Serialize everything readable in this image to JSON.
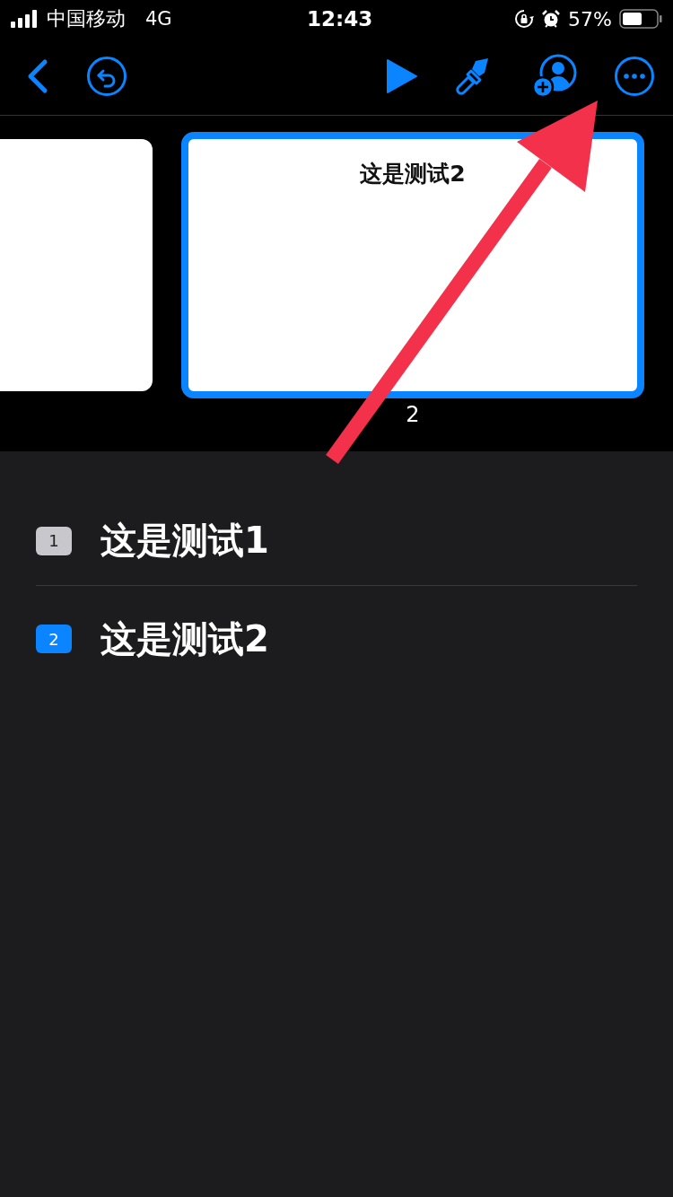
{
  "status_bar": {
    "carrier": "中国移动",
    "network": "4G",
    "time": "12:43",
    "battery_percent": "57%"
  },
  "toolbar": {
    "buttons": [
      {
        "kind": "back"
      },
      {
        "kind": "undo"
      },
      {
        "kind": "play"
      },
      {
        "kind": "brush"
      },
      {
        "kind": "collaborate"
      },
      {
        "kind": "more"
      }
    ]
  },
  "slides": [
    {
      "selected": false
    },
    {
      "selected": true,
      "title": "这是测试2",
      "number": "2"
    }
  ],
  "outline": [
    {
      "number": "1",
      "title": "这是测试1",
      "selected": false
    },
    {
      "number": "2",
      "title": "这是测试2",
      "selected": true
    }
  ],
  "annotation": {
    "kind": "arrow"
  }
}
